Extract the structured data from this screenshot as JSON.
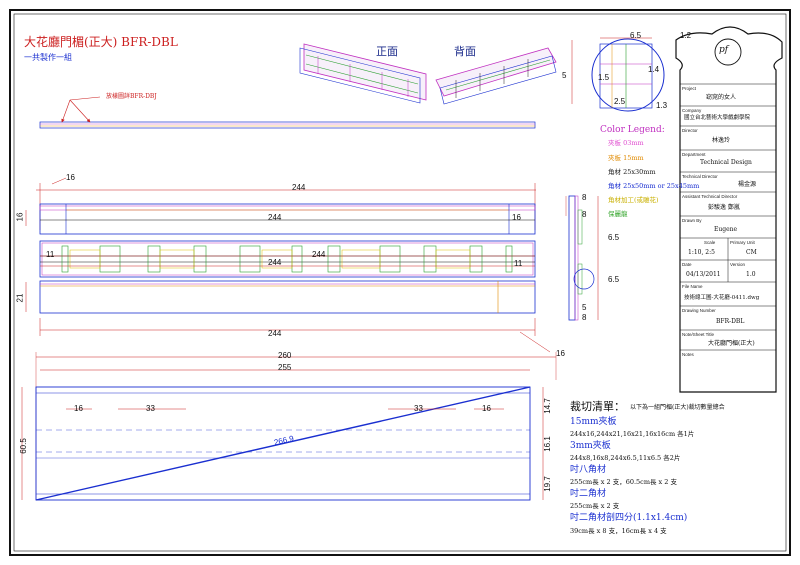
{
  "title": "大花廳門楣(正大) BFR-DBL",
  "subtitle": "一共製作一組",
  "view_front": "正面",
  "view_back": "背面",
  "detail_callout": "放樣圖詳BFR-DBJ",
  "legend": {
    "heading": "Color Legend:",
    "items": [
      {
        "text": "夾板 03mm",
        "color": "#e04fd0"
      },
      {
        "text": "夾板 15mm",
        "color": "#e08a00"
      },
      {
        "text": "角材 25x30mm",
        "color": "#222222"
      },
      {
        "text": "角材 25x50mm or 25x45mm",
        "color": "#1a2fd0"
      },
      {
        "text": "角材加工(或雕花)",
        "color": "#d9c200"
      },
      {
        "text": "保麗龍",
        "color": "#3aa832"
      }
    ]
  },
  "dims": {
    "top_16": "16",
    "top_244": "244",
    "inner_244a": "244",
    "inner_16a": "16",
    "left_16": "16",
    "e11a": "11",
    "e244b": "244",
    "e244c": "244",
    "e11b": "11",
    "e21": "21",
    "bottom_244": "244",
    "d260": "260",
    "d255": "255",
    "d16r": "16",
    "b16": "16",
    "b33a": "33",
    "b33b": "33",
    "b16b": "16",
    "diag": "266.9",
    "v605": "60.5",
    "v147": "14.7",
    "v161": "16.1",
    "v197": "19.7",
    "sec8a": "8",
    "sec8b": "8",
    "sec65a": "6.5",
    "sec65b": "6.5",
    "sec5": "5",
    "sec8c": "8",
    "circ65": "6.5",
    "circ5": "5",
    "circ15": "1.5",
    "circ14": "1.4",
    "circ25": "2.5",
    "circ13": "1.3",
    "circ12": "1.2"
  },
  "cut_list": {
    "heading": "裁切清單：",
    "note": "以下為一組門楣(正大)裁切數量總合",
    "sections": [
      {
        "head": "15mm夾板",
        "body": "244x16,244x21,16x21,16x16cm  各1片"
      },
      {
        "head": "3mm夾板",
        "body": "244x8,16x8,244x6.5,11x6.5      各2片"
      },
      {
        "head": "吋八角材",
        "body": "255cm長 x 2 支，60.5cm長 x 2 支"
      },
      {
        "head": "吋二角材",
        "body": "255cm長 x 2 支"
      },
      {
        "head": "吋二角材剖四分(1.1x1.4cm)",
        "body": "39cm長 x 8 支，16cm長 x 4 支"
      }
    ]
  },
  "title_block": {
    "logo": "pf",
    "project_label": "Project",
    "project": "窈窕的女人",
    "company_label": "Company",
    "company": "國立台北藝術大學戲劇學院",
    "director_label": "Director",
    "director": "林逸玲",
    "department_label": "Department",
    "department": "Technical Design",
    "tech_director_label": "Technical Director",
    "tech_director": "楊金源",
    "assistant_label": "Assistant Technical Director",
    "assistant": "彭駿逸 鄭嵐",
    "drawn_label": "Drawn By",
    "drawn": "Eugene",
    "scale_label": "Scale",
    "scale": "1:10, 2:5",
    "unit_label": "Primary Unit",
    "unit": "CM",
    "date_label": "Date",
    "date": "04/13/2011",
    "version_label": "Version",
    "version": "1.0",
    "file_label": "File Name",
    "file": "技術總工圖-大花廳-0411.dwg",
    "drawing_label": "Drawing Number",
    "drawing": "BFR-DBL",
    "sheet_label": "Note/Sheet Title",
    "sheet": "大花廳門楣(正大)",
    "notes_label": "Notes"
  }
}
